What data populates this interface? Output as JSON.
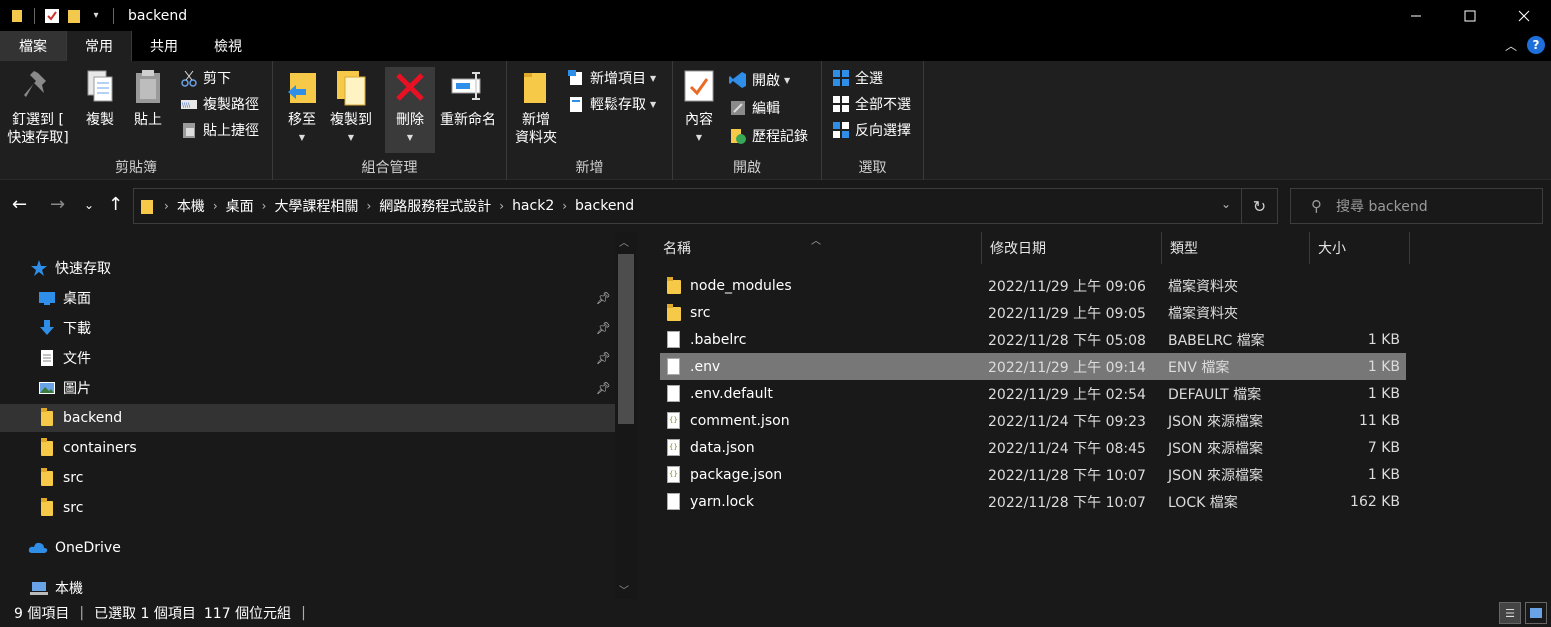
{
  "window": {
    "title": "backend",
    "controls": [
      "minimize",
      "maximize",
      "close"
    ]
  },
  "ribbon_tabs": [
    "檔案",
    "常用",
    "共用",
    "檢視"
  ],
  "ribbon": {
    "clipboard": {
      "label": "剪貼簿",
      "pin_label_1": "釘選到 [",
      "pin_label_2": "快速存取]",
      "copy": "複製",
      "paste": "貼上",
      "cut": "剪下",
      "copy_path": "複製路徑",
      "paste_shortcut": "貼上捷徑"
    },
    "organize": {
      "label": "組合管理",
      "move_to": "移至",
      "copy_to": "複製到",
      "delete": "刪除",
      "rename": "重新命名"
    },
    "new": {
      "label": "新增",
      "new_folder_1": "新增",
      "new_folder_2": "資料夾",
      "new_item": "新增項目",
      "easy_access": "輕鬆存取"
    },
    "open": {
      "label": "開啟",
      "properties": "內容",
      "open": "開啟",
      "edit": "編輯",
      "history": "歷程記錄"
    },
    "select": {
      "label": "選取",
      "select_all": "全選",
      "select_none": "全部不選",
      "invert": "反向選擇"
    }
  },
  "address": {
    "breadcrumbs": [
      "本機",
      "桌面",
      "大學課程相關",
      "網路服務程式設計",
      "hack2",
      "backend"
    ],
    "search_placeholder": "搜尋 backend"
  },
  "nav_pane": {
    "items": [
      {
        "label": "快速存取",
        "icon": "star-icon",
        "pinned": false
      },
      {
        "label": "桌面",
        "icon": "desktop-icon",
        "pinned": true
      },
      {
        "label": "下載",
        "icon": "download-icon",
        "pinned": true
      },
      {
        "label": "文件",
        "icon": "document-icon",
        "pinned": true
      },
      {
        "label": "圖片",
        "icon": "pictures-icon",
        "pinned": true
      },
      {
        "label": "backend",
        "icon": "folder-icon",
        "pinned": false,
        "selected": true
      },
      {
        "label": "containers",
        "icon": "folder-icon",
        "pinned": false
      },
      {
        "label": "src",
        "icon": "folder-icon",
        "pinned": false
      },
      {
        "label": "src",
        "icon": "folder-icon",
        "pinned": false
      },
      {
        "label": "OneDrive",
        "icon": "cloud-icon",
        "pinned": false
      },
      {
        "label": "本機",
        "icon": "computer-icon",
        "pinned": false
      }
    ]
  },
  "columns": {
    "name": "名稱",
    "date": "修改日期",
    "type": "類型",
    "size": "大小"
  },
  "files": [
    {
      "name": "node_modules",
      "date": "2022/11/29 上午 09:06",
      "type": "檔案資料夾",
      "size": "",
      "kind": "folder"
    },
    {
      "name": "src",
      "date": "2022/11/29 上午 09:05",
      "type": "檔案資料夾",
      "size": "",
      "kind": "folder"
    },
    {
      "name": ".babelrc",
      "date": "2022/11/28 下午 05:08",
      "type": "BABELRC 檔案",
      "size": "1 KB",
      "kind": "doc"
    },
    {
      "name": ".env",
      "date": "2022/11/29 上午 09:14",
      "type": "ENV 檔案",
      "size": "1 KB",
      "kind": "doc",
      "selected": true
    },
    {
      "name": ".env.default",
      "date": "2022/11/29 上午 02:54",
      "type": "DEFAULT 檔案",
      "size": "1 KB",
      "kind": "doc"
    },
    {
      "name": "comment.json",
      "date": "2022/11/24 下午 09:23",
      "type": "JSON 來源檔案",
      "size": "11 KB",
      "kind": "json"
    },
    {
      "name": "data.json",
      "date": "2022/11/24 下午 08:45",
      "type": "JSON 來源檔案",
      "size": "7 KB",
      "kind": "json"
    },
    {
      "name": "package.json",
      "date": "2022/11/28 下午 10:07",
      "type": "JSON 來源檔案",
      "size": "1 KB",
      "kind": "json"
    },
    {
      "name": "yarn.lock",
      "date": "2022/11/28 下午 10:07",
      "type": "LOCK 檔案",
      "size": "162 KB",
      "kind": "doc"
    }
  ],
  "status": {
    "count": "9 個項目",
    "selected": "已選取 1 個項目",
    "size": "117 個位元組"
  }
}
